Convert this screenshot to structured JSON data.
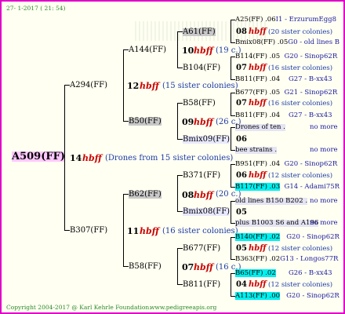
{
  "header": {
    "date": "27- 1-2017 ( 21: 54)"
  },
  "footer": {
    "copyright": "Copyright 2004-2017 @ Karl Kehrle Foundation.",
    "url": "www.pedigreeapis.org"
  },
  "hbff": "hbff",
  "root": {
    "name": "A509(FF)",
    "num": "14",
    "sisters": "(Drones from 15 sister colonies)"
  },
  "gen1": [
    {
      "name": "A294(FF)",
      "num": "12",
      "sisters": "(15 sister colonies)"
    },
    {
      "name": "B307(FF)",
      "num": "11",
      "sisters": "(16 sister colonies)"
    }
  ],
  "gen2": [
    {
      "name": "A144(FF)",
      "num": "10",
      "sisters": "(19 c.)"
    },
    {
      "name": "B50(FF)",
      "num": "09",
      "sisters": "(26 c.)"
    },
    {
      "name": "B62(FF)",
      "num": "08",
      "sisters": "(20 c.)"
    },
    {
      "name": "B58(FF)",
      "num": "07",
      "sisters": "(16 c.)"
    }
  ],
  "gen3": [
    {
      "name": "A61(FF)",
      "num": "08",
      "sisters": "(20 sister colonies)"
    },
    {
      "name": "B104(FF)",
      "num": "07",
      "sisters": "(16 sister colonies)"
    },
    {
      "name": "B58(FF)",
      "num": "07",
      "sisters": "(16 sister colonies)"
    },
    {
      "name": "Bmix09(FF)",
      "num": "06",
      "drones_l1": "Drones of ten .",
      "drones_l2": "bee strains .",
      "more": "no more"
    },
    {
      "name": "B371(FF)",
      "num": "06",
      "sisters": "(12 sister colonies)"
    },
    {
      "name": "Bmix08(FF)",
      "num": "05",
      "drones_l1": "old lines B150 B202 .",
      "drones_l2": "plus B1003 S6 and A196",
      "more": "no more"
    },
    {
      "name": "B677(FF)",
      "num": "05",
      "sisters": "(12 sister colonies)"
    },
    {
      "name": "B811(FF)",
      "num": "04",
      "sisters": "(12 sister colonies)"
    }
  ],
  "gen4": [
    {
      "name": "A25(FF)",
      "val": ".06",
      "info": "I1 - ErzurumEgg8"
    },
    {
      "name": "Bmix08(FF)",
      "val": ".05",
      "info": "G0 - old lines B"
    },
    {
      "name": "B114(FF)",
      "val": ".05",
      "info": "G20 - Sinop62R"
    },
    {
      "name": "B811(FF)",
      "val": ".04",
      "info": "G27 - B-xx43"
    },
    {
      "name": "B677(FF)",
      "val": ".05",
      "info": "G21 - Sinop62R"
    },
    {
      "name": "B811(FF)",
      "val": ".04",
      "info": "G27 - B-xx43"
    },
    {
      "name": "B951(FF)",
      "val": ".04",
      "info": "G20 - Sinop62R"
    },
    {
      "name": "B117(FF)",
      "val": ".03",
      "info": "G14 - Adami75R"
    },
    {
      "name": "B140(FF)",
      "val": ".02",
      "info": "G20 - Sinop62R"
    },
    {
      "name": "B363(FF)",
      "val": ".02",
      "info": "G13 - Longos77R"
    },
    {
      "name": "B65(FF)",
      "val": ".02",
      "info": "G26 - B-xx43"
    },
    {
      "name": "A113(FF)",
      "val": ".00",
      "info": "G20 - Sinop62R"
    }
  ]
}
